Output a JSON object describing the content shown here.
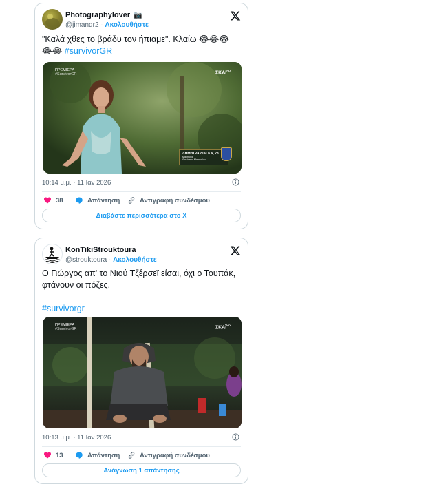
{
  "tweets": [
    {
      "author_name": "Photographylover",
      "author_badge": "📷",
      "handle": "@jimandr2",
      "separator": "·",
      "follow_label": "Ακολουθήστε",
      "text": "\"Καλά χθες το βράδυ τον ήπιαμε\". Κλαίω 😂😂😂",
      "text_line2_emoji": "😂😂",
      "hashtag": "#survivorGR",
      "media": {
        "top_left_label": "ΠΡΕΜΙΕΡΑ",
        "top_left_sub": "#SurvivorGR",
        "channel": "ΣΚΑΪ",
        "channel_hd": "HD",
        "lower_third_name": "ΔΗΜΗΤΡΑ ΛΙΑΓΚΑ, 28",
        "lower_third_sub1": "Μαχήτρια",
        "lower_third_sub2": "Θαλάσσιο Μαρσούπι"
      },
      "timestamp": "10:14 μ.μ. · 11 Ιαν 2026",
      "like_count": "38",
      "reply_label": "Απάντηση",
      "copy_label": "Αντιγραφή συνδέσμου",
      "more_label": "Διαβάστε περισσότερα στο Χ"
    },
    {
      "author_name": "KonTikiStrouktoura",
      "handle": "@strouktoura",
      "separator": "·",
      "follow_label": "Ακολουθήστε",
      "text": "Ο Γιώργος απ' το Νιού Τζέρσεϊ είσαι, όχι ο Τουπάκ, φτάνουν οι πόζες.",
      "hashtag": "#survivorgr",
      "media": {
        "top_left_label": "ΠΡΕΜΙΕΡΑ",
        "top_left_sub": "#SurvivorGR",
        "channel": "ΣΚΑΪ",
        "channel_hd": "HD"
      },
      "timestamp": "10:13 μ.μ. · 11 Ιαν 2026",
      "like_count": "13",
      "reply_label": "Απάντηση",
      "copy_label": "Αντιγραφή συνδέσμου",
      "more_label": "Ανάγνωση 1 απάντησης"
    }
  ],
  "colors": {
    "link_blue": "#1d9bf0",
    "like_pink": "#f91880",
    "text_dark": "#0f1419",
    "text_gray": "#536471",
    "border": "#cfd9de"
  },
  "icons": [
    "x-logo-icon",
    "info-icon",
    "heart-icon",
    "reply-bubble-icon",
    "link-icon"
  ]
}
